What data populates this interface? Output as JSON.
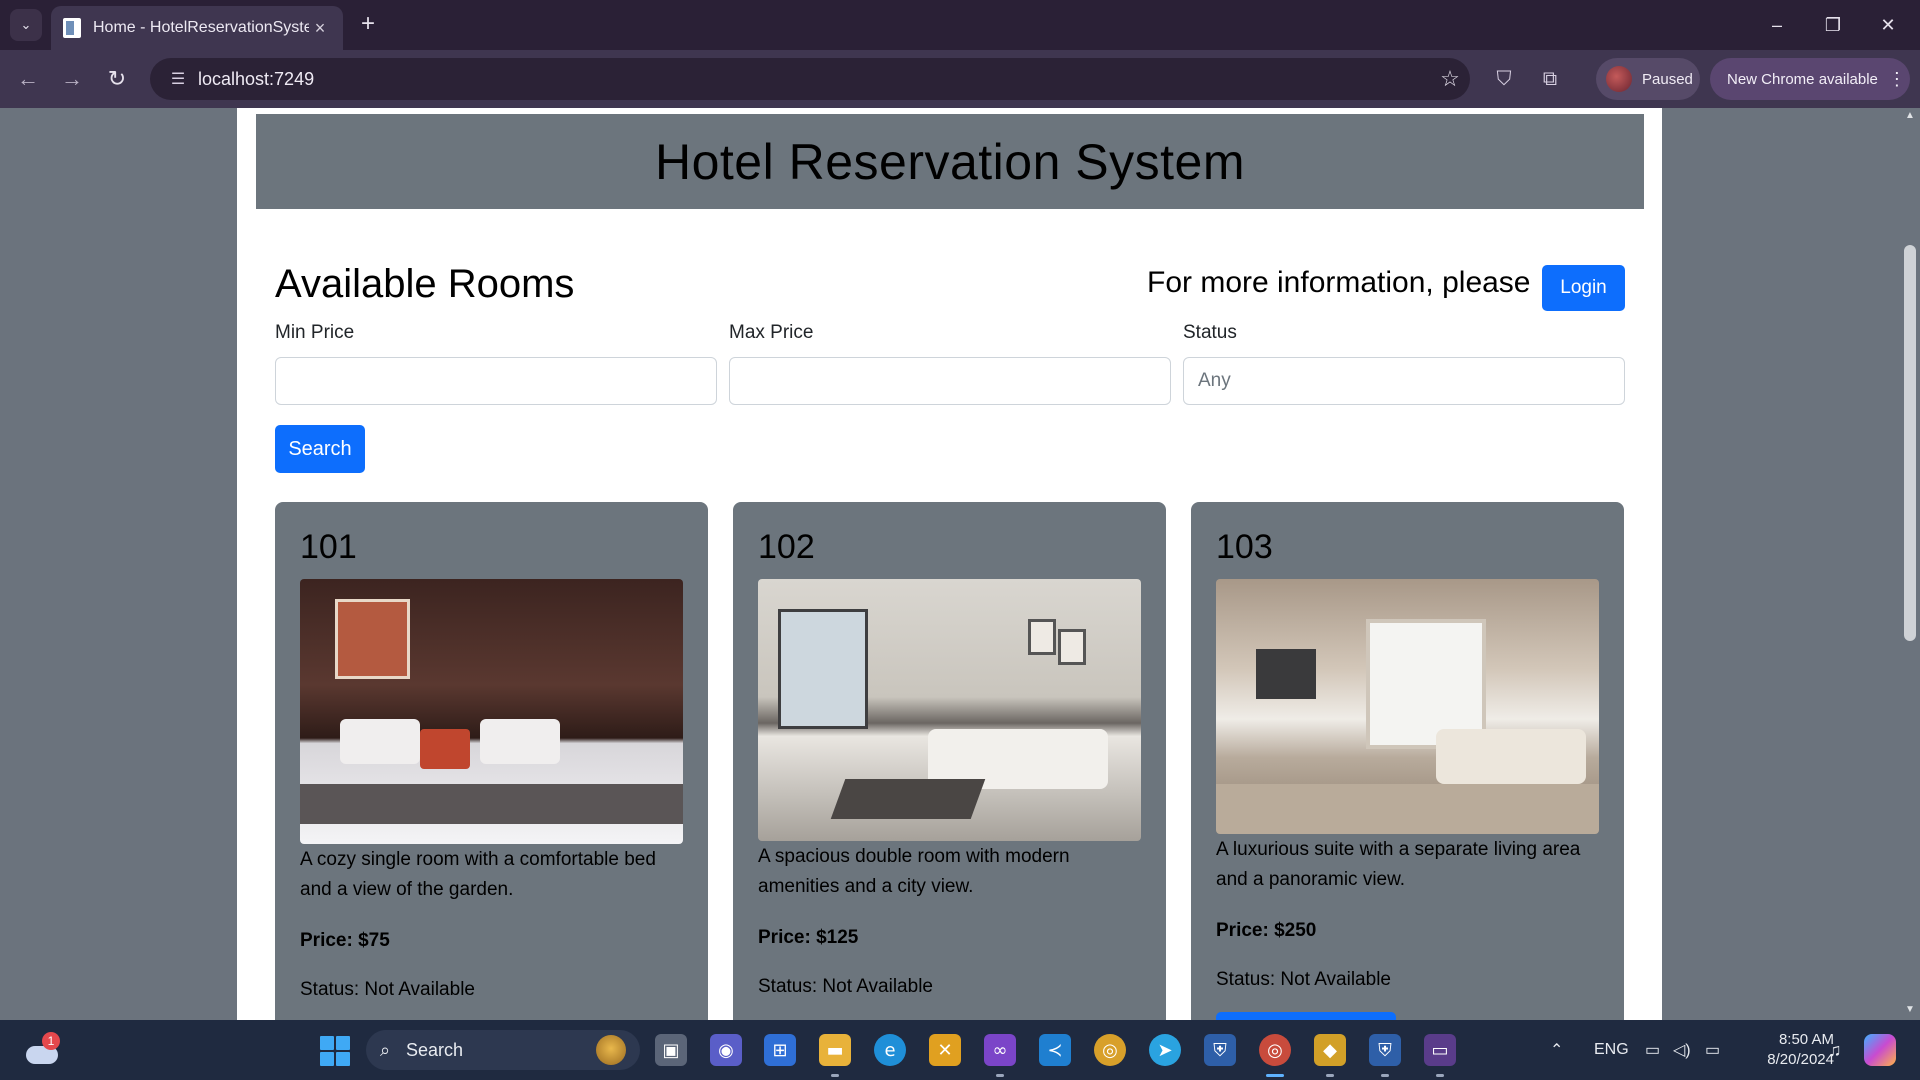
{
  "browser": {
    "tab_title": "Home - HotelReservationSystem",
    "url": "localhost:7249",
    "profile_status": "Paused",
    "update_label": "New Chrome available"
  },
  "page": {
    "header_title": "Hotel Reservation System",
    "rooms_title": "Available Rooms",
    "info_text": "For more information, please",
    "login_label": "Login",
    "filters": {
      "min_price_label": "Min Price",
      "min_price_value": "",
      "max_price_label": "Max Price",
      "max_price_value": "",
      "status_label": "Status",
      "status_value": "Any"
    },
    "search_label": "Search",
    "rooms": [
      {
        "number": "101",
        "description": "A cozy single room with a comfortable bed and a view of the garden.",
        "price": "Price: $75",
        "status": "Status: Not Available"
      },
      {
        "number": "102",
        "description": "A spacious double room with modern amenities and a city view.",
        "price": "Price: $125",
        "status": "Status: Not Available"
      },
      {
        "number": "103",
        "description": "A luxurious suite with a separate living area and a panoramic view.",
        "price": "Price: $250",
        "status": "Status: Not Available"
      }
    ]
  },
  "taskbar": {
    "search_label": "Search",
    "weather_badge": "1",
    "language": "ENG",
    "time": "8:50 AM",
    "date": "8/20/2024"
  },
  "colors": {
    "primary_button": "#0d6efd",
    "header_bg": "#6c757d",
    "card_bg": "#6c757d"
  }
}
